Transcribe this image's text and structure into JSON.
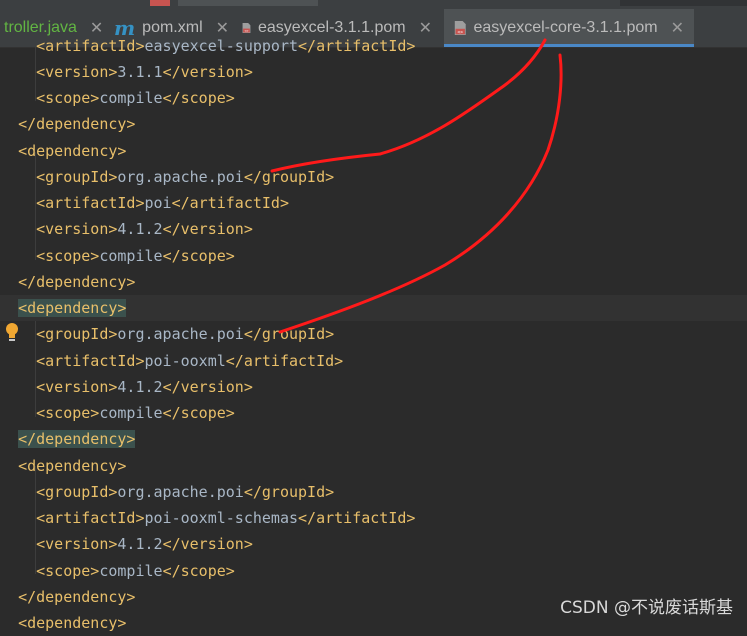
{
  "tabs": [
    {
      "label": "troller.java",
      "type": "java"
    },
    {
      "label": "pom.xml",
      "type": "maven"
    },
    {
      "label": "easyexcel-3.1.1.pom",
      "type": "pom"
    },
    {
      "label": "easyexcel-core-3.1.1.pom",
      "type": "pom",
      "active": true
    }
  ],
  "code": {
    "l0": {
      "open": "<artifactId>",
      "text": "easyexcel-support",
      "close": "</artifactId>"
    },
    "l1": {
      "open": "<version>",
      "text": "3.1.1",
      "close": "</version>"
    },
    "l2": {
      "open": "<scope>",
      "text": "compile",
      "close": "</scope>"
    },
    "l3": {
      "tag": "</dependency>"
    },
    "l4": {
      "tag": "<dependency>"
    },
    "l5": {
      "open": "<groupId>",
      "text": "org.apache.poi",
      "close": "</groupId>"
    },
    "l6": {
      "open": "<artifactId>",
      "text": "poi",
      "close": "</artifactId>"
    },
    "l7": {
      "open": "<version>",
      "text": "4.1.2",
      "close": "</version>"
    },
    "l8": {
      "open": "<scope>",
      "text": "compile",
      "close": "</scope>"
    },
    "l9": {
      "tag": "</dependency>"
    },
    "l10": {
      "tag": "<dependency>"
    },
    "l11": {
      "open": "<groupId>",
      "text": "org.apache.poi",
      "close": "</groupId>"
    },
    "l12": {
      "open": "<artifactId>",
      "text": "poi-ooxml",
      "close": "</artifactId>"
    },
    "l13": {
      "open": "<version>",
      "text": "4.1.2",
      "close": "</version>"
    },
    "l14": {
      "open": "<scope>",
      "text": "compile",
      "close": "</scope>"
    },
    "l15": {
      "tag": "</dependency>"
    },
    "l16": {
      "tag": "<dependency>"
    },
    "l17": {
      "open": "<groupId>",
      "text": "org.apache.poi",
      "close": "</groupId>"
    },
    "l18": {
      "open": "<artifactId>",
      "text": "poi-ooxml-schemas",
      "close": "</artifactId>"
    },
    "l19": {
      "open": "<version>",
      "text": "4.1.2",
      "close": "</version>"
    },
    "l20": {
      "open": "<scope>",
      "text": "compile",
      "close": "</scope>"
    },
    "l21": {
      "tag": "</dependency>"
    },
    "l22": {
      "tag": "<dependency>"
    }
  },
  "watermark": "CSDN @不说废话斯基",
  "colors": {
    "tag": "#e8bf6a",
    "text": "#a9b7c6",
    "annotation": "#ff1a1a",
    "tab_underline": "#4a88c7"
  }
}
